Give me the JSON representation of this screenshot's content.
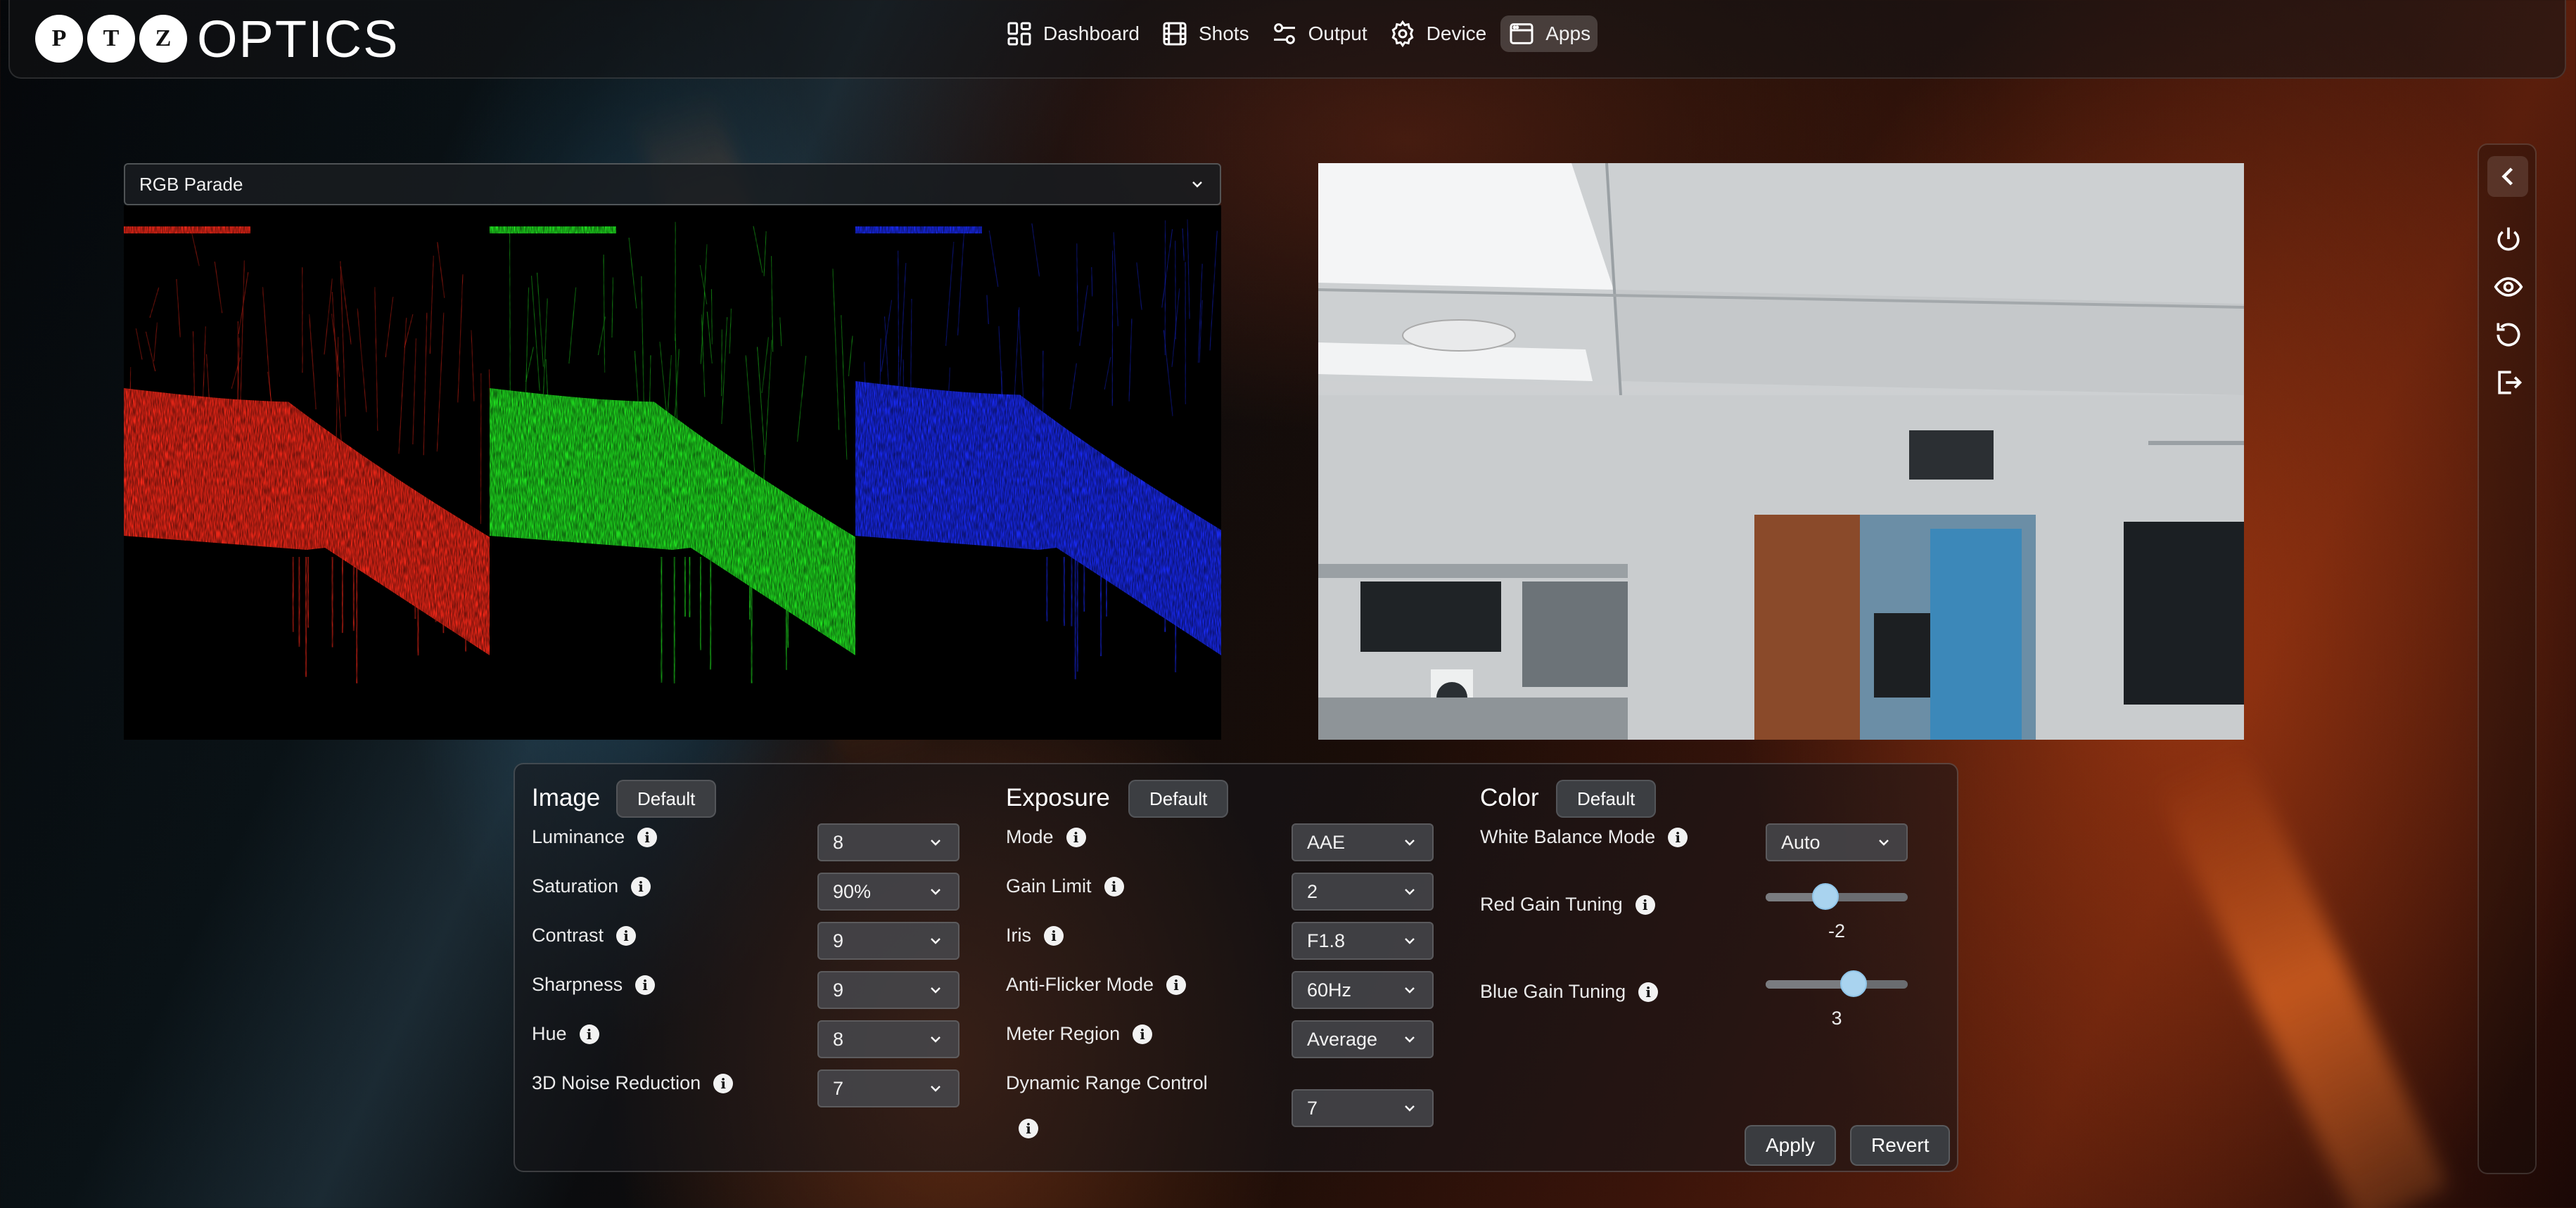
{
  "brand": {
    "logo_letters": [
      "P",
      "T",
      "Z"
    ],
    "logo_text": "OPTICS"
  },
  "nav": {
    "items": [
      {
        "label": "Dashboard",
        "icon": "dashboard-grid-icon"
      },
      {
        "label": "Shots",
        "icon": "film-icon"
      },
      {
        "label": "Output",
        "icon": "sliders-icon"
      },
      {
        "label": "Device",
        "icon": "gear-icon"
      },
      {
        "label": "Apps",
        "icon": "window-icon",
        "active": true
      }
    ]
  },
  "scope": {
    "selected": "RGB Parade",
    "channel_colors": [
      "#ff2a1a",
      "#22ee22",
      "#1a2cff"
    ]
  },
  "rail": {
    "icons": [
      "chevron-left-icon",
      "power-icon",
      "eye-icon",
      "refresh-icon",
      "logout-icon"
    ]
  },
  "image": {
    "title": "Image",
    "default_label": "Default",
    "rows": [
      {
        "label": "Luminance",
        "value": "8"
      },
      {
        "label": "Saturation",
        "value": "90%"
      },
      {
        "label": "Contrast",
        "value": "9"
      },
      {
        "label": "Sharpness",
        "value": "9"
      },
      {
        "label": "Hue",
        "value": "8"
      },
      {
        "label": "3D Noise Reduction",
        "value": "7"
      }
    ]
  },
  "exposure": {
    "title": "Exposure",
    "default_label": "Default",
    "rows": [
      {
        "label": "Mode",
        "value": "AAE"
      },
      {
        "label": "Gain Limit",
        "value": "2"
      },
      {
        "label": "Iris",
        "value": "F1.8"
      },
      {
        "label": "Anti-Flicker Mode",
        "value": "60Hz"
      },
      {
        "label": "Meter Region",
        "value": "Average"
      },
      {
        "label": "Dynamic Range Control",
        "value": "7"
      }
    ]
  },
  "color": {
    "title": "Color",
    "default_label": "Default",
    "white_balance": {
      "label": "White Balance Mode",
      "value": "Auto"
    },
    "red_gain": {
      "label": "Red Gain Tuning",
      "value": "-2",
      "fraction": 0.42
    },
    "blue_gain": {
      "label": "Blue Gain Tuning",
      "value": "3",
      "fraction": 0.62
    }
  },
  "actions": {
    "apply": "Apply",
    "revert": "Revert"
  },
  "theme": {
    "accent": "#a9d3ef"
  }
}
